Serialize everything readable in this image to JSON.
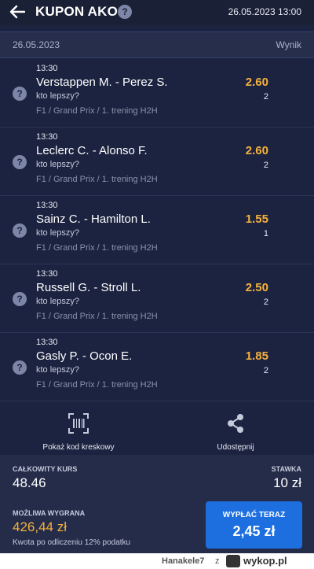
{
  "header": {
    "title": "KUPON AKO",
    "help": "?",
    "datetime": "26.05.2023 13:00"
  },
  "date_bar": {
    "date": "26.05.2023",
    "result_label": "Wynik"
  },
  "bets": [
    {
      "time": "13:30",
      "match": "Verstappen M. - Perez S.",
      "market": "kto lepszy?",
      "path": "F1 / Grand Prix / 1. trening H2H",
      "odds": "2.60",
      "pick": "2"
    },
    {
      "time": "13:30",
      "match": "Leclerc C. - Alonso F.",
      "market": "kto lepszy?",
      "path": "F1 / Grand Prix / 1. trening H2H",
      "odds": "2.60",
      "pick": "2"
    },
    {
      "time": "13:30",
      "match": "Sainz C. - Hamilton L.",
      "market": "kto lepszy?",
      "path": "F1 / Grand Prix / 1. trening H2H",
      "odds": "1.55",
      "pick": "1"
    },
    {
      "time": "13:30",
      "match": "Russell G. - Stroll L.",
      "market": "kto lepszy?",
      "path": "F1 / Grand Prix / 1. trening H2H",
      "odds": "2.50",
      "pick": "2"
    },
    {
      "time": "13:30",
      "match": "Gasly P. - Ocon E.",
      "market": "kto lepszy?",
      "path": "F1 / Grand Prix / 1. trening H2H",
      "odds": "1.85",
      "pick": "2"
    }
  ],
  "actions": {
    "barcode_label": "Pokaż kod kreskowy",
    "share_label": "Udostępnij"
  },
  "summary": {
    "total_odds_label": "CAŁKOWITY KURS",
    "total_odds": "48.46",
    "stake_label": "STAWKA",
    "stake": "10 zł",
    "win_label": "MOŻLIWA WYGRANA",
    "win": "426,44 zł",
    "tax_note": "Kwota po odliczeniu 12% podatku",
    "cashout_label": "WYPŁAĆ TERAZ",
    "cashout_value": "2,45 zł"
  },
  "footer": {
    "username": "Hanakele7",
    "z": "z",
    "logo": "wykop.pl"
  },
  "colors": {
    "background": "#1c2340",
    "odds": "#f5b13c",
    "cashout": "#1d6fe0"
  }
}
